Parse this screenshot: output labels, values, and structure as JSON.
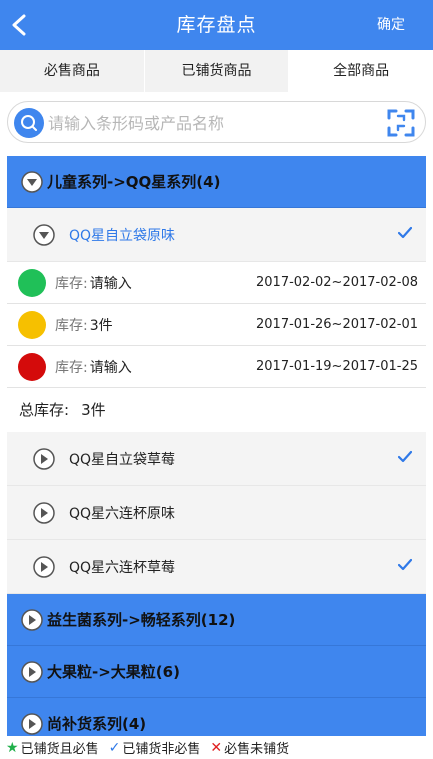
{
  "header": {
    "title": "库存盘点",
    "confirm_label": "确定",
    "bg_color": "#3f86ee"
  },
  "tabs": [
    {
      "label": "必售商品",
      "active": false
    },
    {
      "label": "已铺货商品",
      "active": false
    },
    {
      "label": "全部商品",
      "active": true
    }
  ],
  "search": {
    "placeholder": "请输入条形码或产品名称",
    "value": ""
  },
  "groups": [
    {
      "label": "儿童系列->QQ星系列(4)",
      "expanded": true,
      "items": [
        {
          "name": "QQ星自立袋原味",
          "expanded": true,
          "checked": true,
          "stock_rows": [
            {
              "color": "#20c058",
              "label": "库存:",
              "value": "请输入",
              "dates": "2017-02-02~2017-02-08"
            },
            {
              "color": "#f6c000",
              "label": "库存:",
              "value": "3件",
              "dates": "2017-01-26~2017-02-01"
            },
            {
              "color": "#d40b0b",
              "label": "库存:",
              "value": "请输入",
              "dates": "2017-01-19~2017-01-25"
            }
          ],
          "total_label": "总库存:",
          "total_value": "3件"
        },
        {
          "name": "QQ星自立袋草莓",
          "expanded": false,
          "checked": true
        },
        {
          "name": "QQ星六连杯原味",
          "expanded": false,
          "checked": false
        },
        {
          "name": "QQ星六连杯草莓",
          "expanded": false,
          "checked": true
        }
      ]
    },
    {
      "label": "益生菌系列->畅轻系列(12)",
      "expanded": false
    },
    {
      "label": "大果粒->大果粒(6)",
      "expanded": false
    },
    {
      "label": "尚补货系列(4)",
      "expanded": false
    }
  ],
  "legend": [
    {
      "symbol": "★",
      "color": "#20b04a",
      "label": "已铺货且必售"
    },
    {
      "symbol": "✓",
      "color": "#2f79e8",
      "label": "已铺货非必售"
    },
    {
      "symbol": "✕",
      "color": "#e02020",
      "label": "必售未铺货"
    }
  ]
}
